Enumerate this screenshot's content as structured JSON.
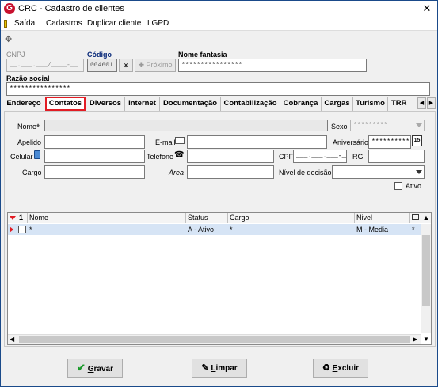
{
  "window": {
    "title": "CRC - Cadastro de clientes",
    "icon_letter": "G",
    "close": "✕"
  },
  "menu": [
    "Saída",
    "Cadastros",
    "Duplicar cliente",
    "LGPD"
  ],
  "header": {
    "cnpj_label": "CNPJ",
    "cnpj_value": "__.___.___/____-__",
    "codigo_label": "Código",
    "codigo_value": "004601",
    "proximo_label": "Próximo",
    "nome_fantasia_label": "Nome fantasia",
    "nome_fantasia_value": "****************",
    "razao_social_label": "Razão social",
    "razao_social_value": "****************"
  },
  "tabs": [
    "Endereço",
    "Contatos",
    "Diversos",
    "Internet",
    "Documentação",
    "Contabilização",
    "Cobrança",
    "Cargas",
    "Turismo",
    "TRR"
  ],
  "contatos": {
    "nome_label": "Nome",
    "sexo_label": "Sexo",
    "sexo_value": "*********",
    "apelido_label": "Apelido",
    "email_label": "E-mail",
    "aniversario_label": "Aniversário",
    "aniversario_value": "**********",
    "aniversario_btn": "15",
    "celular_label": "Celular",
    "telefone_label": "Telefone",
    "cpf_label": "CPF",
    "cpf_value": "___.___.___-__",
    "rg_label": "RG",
    "cargo_label": "Cargo",
    "area_label": "Área",
    "nivel_label": "Nível de decisão",
    "ativo_label": "Ativo"
  },
  "grid": {
    "sort_indicator": "1",
    "columns": [
      "Nome",
      "Status",
      "Cargo",
      "Nivel"
    ],
    "rows": [
      {
        "nome": "*",
        "status": "A - Ativo",
        "cargo": "*",
        "nivel": "M - Media",
        "extra": "*"
      }
    ]
  },
  "footer": {
    "gravar_prefix": "",
    "gravar_u": "G",
    "gravar_rest": "ravar",
    "limpar_u": "L",
    "limpar_rest": "impar",
    "excluir_u": "E",
    "excluir_rest": "xcluir"
  },
  "colors": {
    "accent_red": "#e21c24",
    "title_icon": "#c8102e",
    "grid_selected": "#d6e4f5",
    "ok_green": "#1a9a2a"
  }
}
